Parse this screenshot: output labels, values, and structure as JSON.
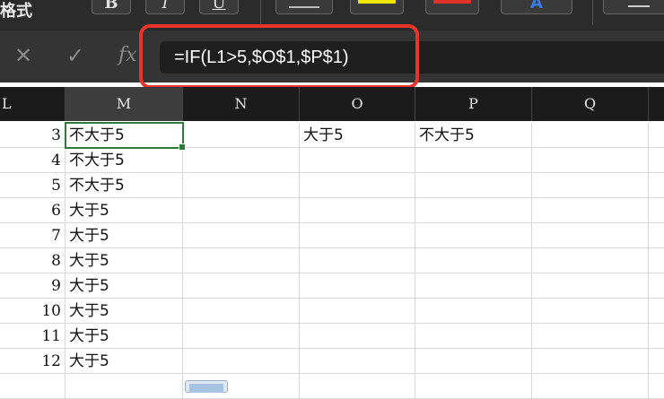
{
  "toolbar": {
    "format_label": "格式",
    "bold_label": "B",
    "italic_label": "I",
    "underline_label": "U",
    "font_color_label": "A",
    "highlight_color": "#f2e600",
    "font_color": "#e0302a",
    "accent_blue": "#2f6fd1"
  },
  "formula_bar": {
    "cancel_icon": "✕",
    "enter_icon": "✓",
    "fx_label": "fx",
    "formula": "=IF(L1>5,$O$1,$P$1)",
    "highlight_color": "#e8352b"
  },
  "columns": [
    "L",
    "M",
    "N",
    "O",
    "P",
    "Q"
  ],
  "selected_column": "M",
  "rows": [
    {
      "L": "3",
      "M": "不大于5",
      "N": "",
      "O": "大于5",
      "P": "不大于5",
      "Q": ""
    },
    {
      "L": "4",
      "M": "不大于5",
      "N": "",
      "O": "",
      "P": "",
      "Q": ""
    },
    {
      "L": "5",
      "M": "不大于5",
      "N": "",
      "O": "",
      "P": "",
      "Q": ""
    },
    {
      "L": "6",
      "M": "大于5",
      "N": "",
      "O": "",
      "P": "",
      "Q": ""
    },
    {
      "L": "7",
      "M": "大于5",
      "N": "",
      "O": "",
      "P": "",
      "Q": ""
    },
    {
      "L": "8",
      "M": "大于5",
      "N": "",
      "O": "",
      "P": "",
      "Q": ""
    },
    {
      "L": "9",
      "M": "大于5",
      "N": "",
      "O": "",
      "P": "",
      "Q": ""
    },
    {
      "L": "10",
      "M": "大于5",
      "N": "",
      "O": "",
      "P": "",
      "Q": ""
    },
    {
      "L": "11",
      "M": "大于5",
      "N": "",
      "O": "",
      "P": "",
      "Q": ""
    },
    {
      "L": "12",
      "M": "大于5",
      "N": "",
      "O": "",
      "P": "",
      "Q": ""
    }
  ]
}
